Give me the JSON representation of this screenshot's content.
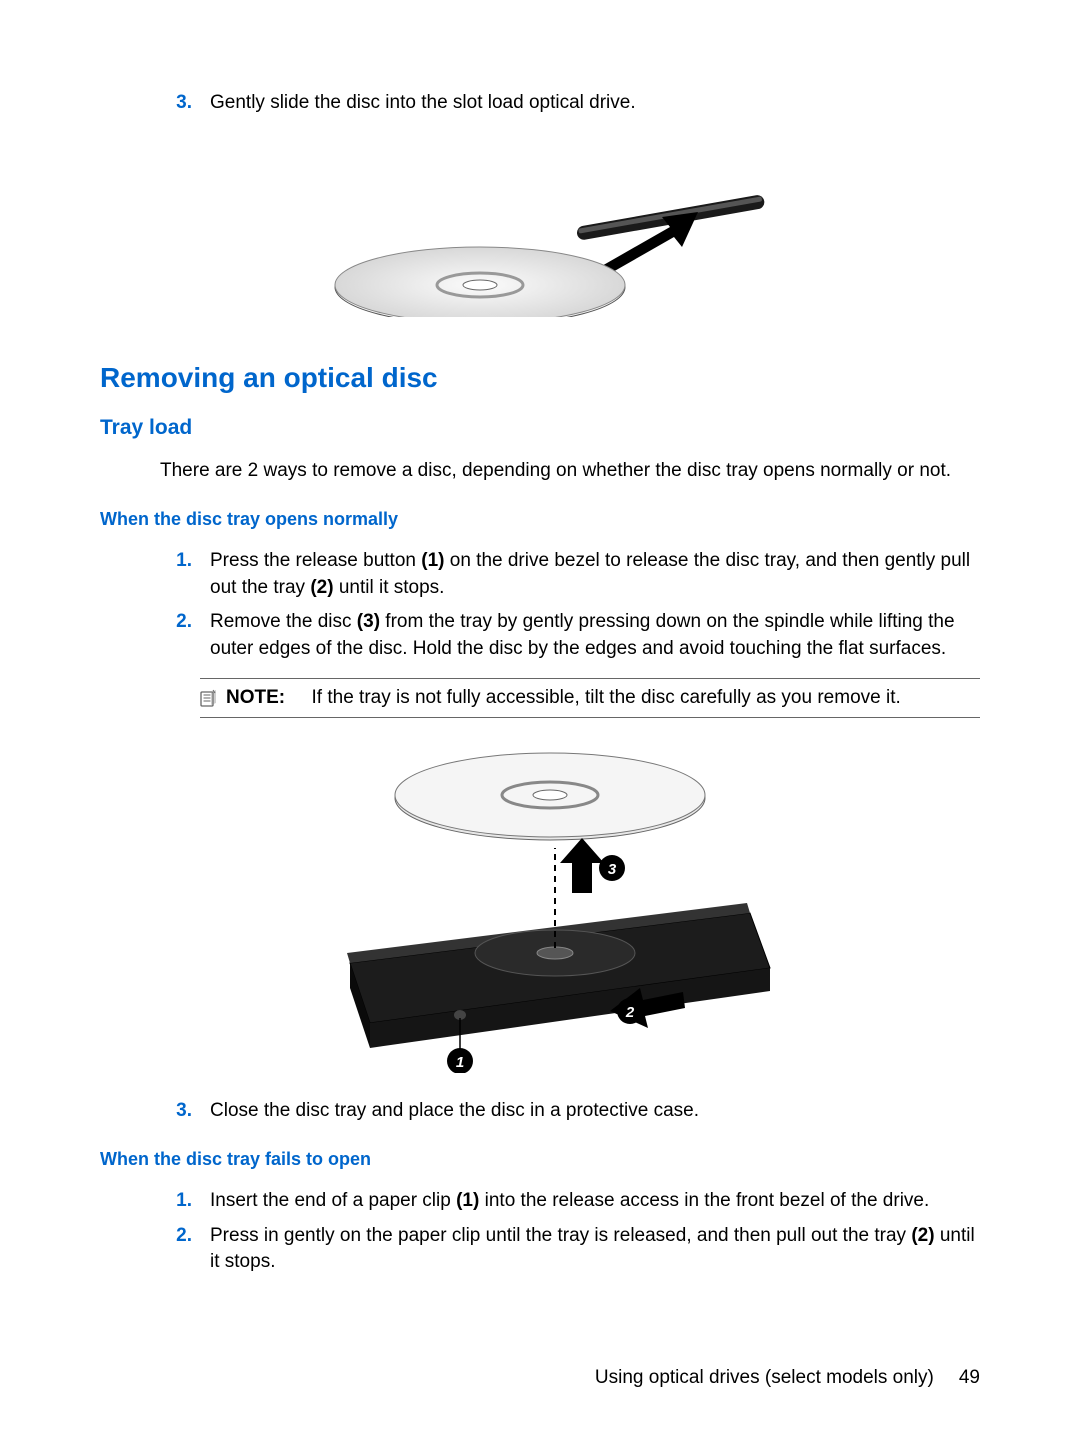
{
  "intro_step": {
    "num": "3.",
    "text": "Gently slide the disc into the slot load optical drive."
  },
  "figure1_alt": "[ Illustration: disc sliding into slot-load drive ]",
  "heading_main": "Removing an optical disc",
  "heading_sub": "Tray load",
  "tray_intro": "There are 2 ways to remove a disc, depending on whether the disc tray opens normally or not.",
  "heading_normal": "When the disc tray opens normally",
  "steps_normal": [
    {
      "num": "1.",
      "parts": [
        "Press the release button ",
        "(1)",
        " on the drive bezel to release the disc tray, and then gently pull out the tray ",
        "(2)",
        " until it stops."
      ]
    },
    {
      "num": "2.",
      "parts": [
        "Remove the disc ",
        "(3)",
        " from the tray by gently pressing down on the spindle while lifting the outer edges of the disc. Hold the disc by the edges and avoid touching the flat surfaces."
      ]
    }
  ],
  "note": {
    "label": "NOTE:",
    "text": "If the tray is not fully accessible, tilt the disc carefully as you remove it."
  },
  "figure2_alt": "[ Illustration: removing disc from tray — callouts 1, 2, 3 ]",
  "step_normal_3": {
    "num": "3.",
    "text": "Close the disc tray and place the disc in a protective case."
  },
  "heading_fail": "When the disc tray fails to open",
  "steps_fail": [
    {
      "num": "1.",
      "parts": [
        "Insert the end of a paper clip ",
        "(1)",
        " into the release access in the front bezel of the drive."
      ]
    },
    {
      "num": "2.",
      "parts": [
        "Press in gently on the paper clip until the tray is released, and then pull out the tray ",
        "(2)",
        " until it stops."
      ]
    }
  ],
  "footer": {
    "title": "Using optical drives (select models only)",
    "page": "49"
  }
}
